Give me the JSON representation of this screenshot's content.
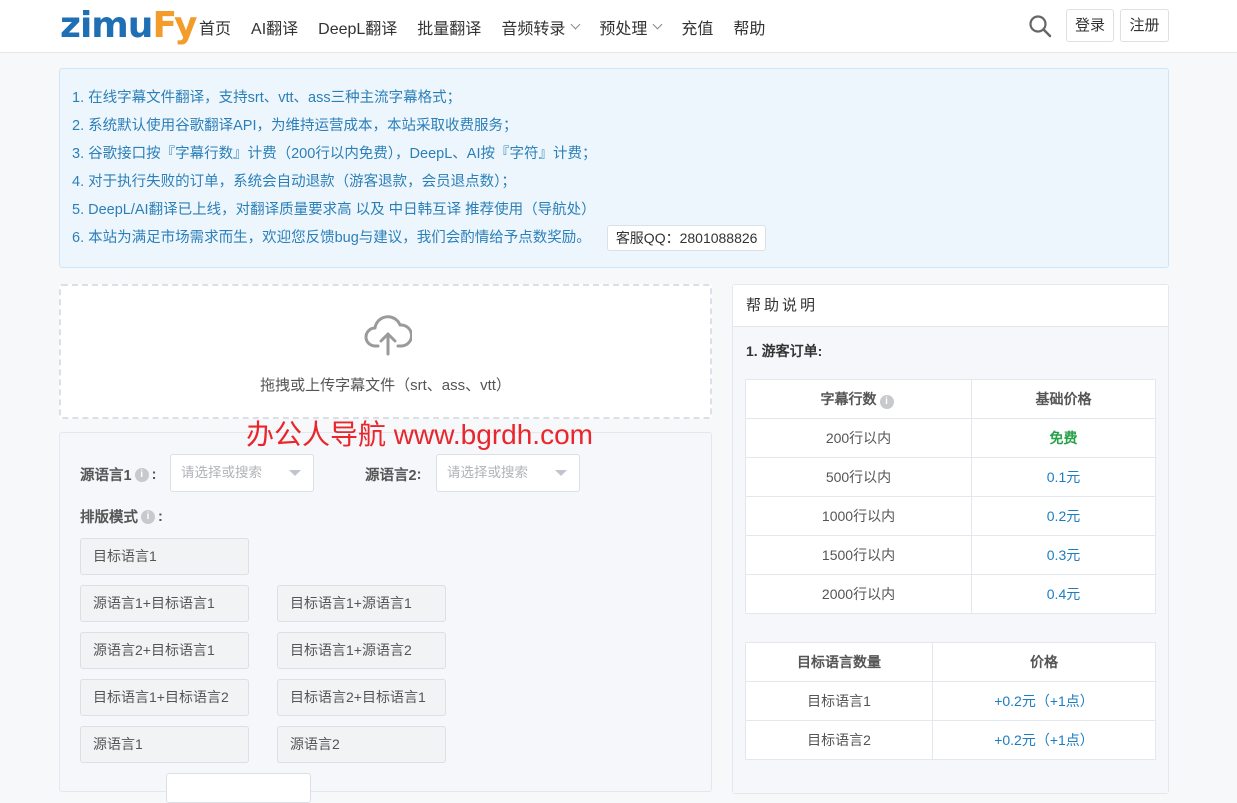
{
  "logo": {
    "part1": "zimu",
    "part2": "Fy"
  },
  "nav": {
    "items": [
      {
        "label": "首页",
        "dropdown": false
      },
      {
        "label": "AI翻译",
        "dropdown": false
      },
      {
        "label": "DeepL翻译",
        "dropdown": false
      },
      {
        "label": "批量翻译",
        "dropdown": false
      },
      {
        "label": "音频转录",
        "dropdown": true
      },
      {
        "label": "预处理",
        "dropdown": true
      },
      {
        "label": "充值",
        "dropdown": false
      },
      {
        "label": "帮助",
        "dropdown": false
      }
    ],
    "login": "登录",
    "register": "注册"
  },
  "notice": {
    "lines": [
      "1. 在线字幕文件翻译，支持srt、vtt、ass三种主流字幕格式；",
      "2. 系统默认使用谷歌翻译API，为维持运营成本，本站采取收费服务；",
      "3. 谷歌接口按『字幕行数』计费（200行以内免费），DeepL、AI按『字符』计费；",
      "4. 对于执行失败的订单，系统会自动退款（游客退款，会员退点数）；",
      "5. DeepL/AI翻译已上线，对翻译质量要求高 以及 中日韩互译 推荐使用（导航处）",
      "6. 本站为满足市场需求而生，欢迎您反馈bug与建议，我们会酌情给予点数奖励。"
    ],
    "qq": "客服QQ：2801088826"
  },
  "upload": {
    "text": "拖拽或上传字幕文件（srt、ass、vtt）"
  },
  "watermark": "办公人导航 www.bgrdh.com",
  "form": {
    "source1_label": "源语言1",
    "source2_label": "源语言2",
    "colon": ":",
    "select_placeholder": "请选择或搜索",
    "layout_label": "排版模式",
    "modes": [
      "目标语言1",
      "源语言1+目标语言1",
      "目标语言1+源语言1",
      "源语言2+目标语言1",
      "目标语言1+源语言2",
      "目标语言1+目标语言2",
      "目标语言2+目标语言1",
      "源语言1",
      "源语言2"
    ]
  },
  "help": {
    "title": "帮助说明",
    "section1": "1. 游客订单:",
    "table1": {
      "headers": [
        "字幕行数",
        "基础价格"
      ],
      "rows": [
        [
          "200行以内",
          "免费"
        ],
        [
          "500行以内",
          "0.1元"
        ],
        [
          "1000行以内",
          "0.2元"
        ],
        [
          "1500行以内",
          "0.3元"
        ],
        [
          "2000行以内",
          "0.4元"
        ]
      ]
    },
    "table2": {
      "headers": [
        "目标语言数量",
        "价格"
      ],
      "rows": [
        [
          "目标语言1",
          "+0.2元（+1点）"
        ],
        [
          "目标语言2",
          "+0.2元（+1点）"
        ]
      ]
    }
  },
  "colors": {
    "brand_blue": "#1f6fb5",
    "brand_orange": "#f39c2a",
    "link": "#1c7dbf",
    "free": "#27a14a",
    "watermark": "#e8262c"
  }
}
